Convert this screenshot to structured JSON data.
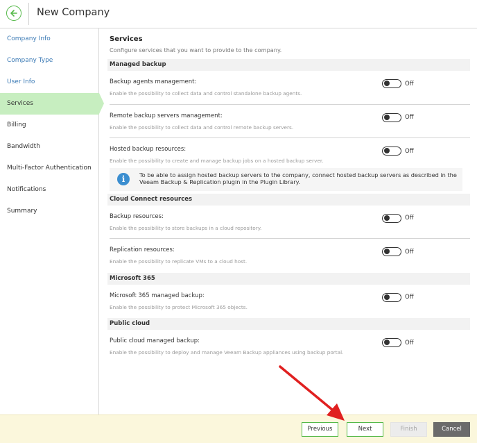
{
  "header": {
    "title": "New Company"
  },
  "sidebar": {
    "items": [
      {
        "label": "Company Info",
        "state": "link"
      },
      {
        "label": "Company Type",
        "state": "link"
      },
      {
        "label": "User Info",
        "state": "link"
      },
      {
        "label": "Services",
        "state": "active"
      },
      {
        "label": "Billing",
        "state": "plain"
      },
      {
        "label": "Bandwidth",
        "state": "plain"
      },
      {
        "label": "Multi-Factor Authentication",
        "state": "plain"
      },
      {
        "label": "Notifications",
        "state": "plain"
      },
      {
        "label": "Summary",
        "state": "plain"
      }
    ]
  },
  "main": {
    "title": "Services",
    "subtitle": "Configure services that you want to provide to the company.",
    "groups": [
      {
        "header": "Managed backup",
        "rows": [
          {
            "label": "Backup agents management:",
            "desc": "Enable the possibility to collect data and control standalone backup agents.",
            "toggle": "Off"
          },
          {
            "label": "Remote backup servers management:",
            "desc": "Enable the possibility to collect data and control remote backup servers.",
            "toggle": "Off"
          },
          {
            "label": "Hosted backup resources:",
            "desc": "Enable the possibility to create and manage backup jobs on a hosted backup server.",
            "toggle": "Off"
          }
        ],
        "info": "To be able to assign hosted backup servers to the company, connect hosted backup servers as described in the Veeam Backup & Replication plugin in the Plugin Library."
      },
      {
        "header": "Cloud Connect resources",
        "rows": [
          {
            "label": "Backup resources:",
            "desc": "Enable the possibility to store backups in a cloud repository.",
            "toggle": "Off"
          },
          {
            "label": "Replication resources:",
            "desc": "Enable the possibility to replicate VMs to a cloud host.",
            "toggle": "Off"
          }
        ]
      },
      {
        "header": "Microsoft 365",
        "rows": [
          {
            "label": "Microsoft 365 managed backup:",
            "desc": "Enable the possibility to protect Microsoft 365 objects.",
            "toggle": "Off"
          }
        ]
      },
      {
        "header": "Public cloud",
        "rows": [
          {
            "label": "Public cloud managed backup:",
            "desc": "Enable the possibility to deploy and manage Veeam Backup appliances using backup portal.",
            "toggle": "Off"
          }
        ]
      }
    ]
  },
  "footer": {
    "previous": "Previous",
    "next": "Next",
    "finish": "Finish",
    "cancel": "Cancel"
  },
  "colors": {
    "accent": "#54b948",
    "active_nav": "#c7eec0",
    "link": "#3b7ab5",
    "footer_bg": "#fbf7dc",
    "annotation_arrow": "#e02020"
  },
  "icons": {
    "back": "back-arrow-circle-icon",
    "info": "info-icon"
  }
}
